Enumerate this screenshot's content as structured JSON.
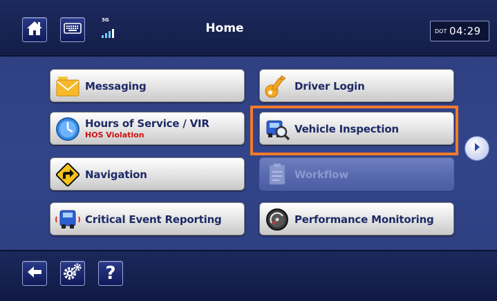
{
  "header": {
    "title": "Home",
    "home_icon": "home-icon",
    "keyboard_icon": "keyboard-icon",
    "signal_label": "3G",
    "clock_prefix": "DOT",
    "clock_time": "04:29"
  },
  "menu": {
    "messaging": {
      "label": "Messaging",
      "icon": "envelope-icon"
    },
    "driver_login": {
      "label": "Driver Login",
      "icon": "key-icon"
    },
    "hours_of_service": {
      "label": "Hours of Service / VIR",
      "status": "HOS Violation",
      "icon": "clock-icon"
    },
    "vehicle_inspection": {
      "label": "Vehicle Inspection",
      "icon": "truck-magnifier-icon"
    },
    "navigation": {
      "label": "Navigation",
      "icon": "turn-sign-icon"
    },
    "workflow": {
      "label": "Workflow",
      "icon": "clipboard-icon",
      "enabled": false
    },
    "critical_event": {
      "label": "Critical Event Reporting",
      "icon": "truck-alert-icon"
    },
    "performance": {
      "label": "Performance Monitoring",
      "icon": "gauge-icon"
    }
  },
  "next_page_icon": "chevron-right-icon",
  "footer": {
    "back_icon": "back-arrow-icon",
    "settings_icon": "gears-icon",
    "help_text": "?"
  },
  "colors": {
    "background": "#33458a",
    "highlight": "#f27b2a",
    "status_alert": "#d01010",
    "label": "#1d2a66"
  }
}
